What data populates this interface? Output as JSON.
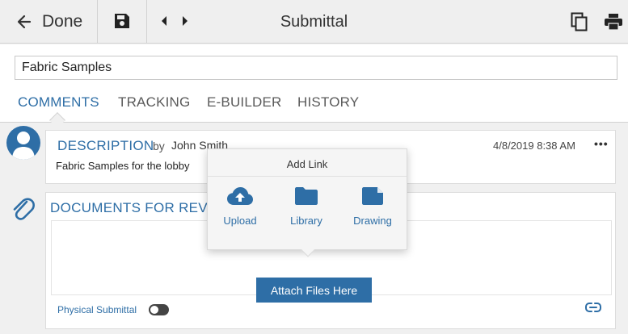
{
  "toolbar": {
    "done_label": "Done",
    "title": "Submittal",
    "icons": [
      "back-arrow-icon",
      "save-icon",
      "prev-icon",
      "next-icon",
      "copy-icon",
      "print-icon"
    ]
  },
  "form": {
    "name_value": "Fabric Samples"
  },
  "tabs": [
    {
      "label": "COMMENTS",
      "active": true
    },
    {
      "label": "TRACKING",
      "active": false
    },
    {
      "label": "E-BUILDER",
      "active": false
    },
    {
      "label": "HISTORY",
      "active": false
    }
  ],
  "description": {
    "title": "DESCRIPTION",
    "by": "by",
    "author": "John Smith",
    "date": "4/8/2019 8:38 AM",
    "more": "•••",
    "text": "Fabric Samples for the lobby"
  },
  "documents": {
    "title": "DOCUMENTS FOR REVIEW",
    "attach_label": "Attach Files Here",
    "physical_label": "Physical Submittal",
    "physical_on": false
  },
  "popup": {
    "title": "Add Link",
    "items": [
      {
        "label": "Upload",
        "icon": "cloud-upload-icon"
      },
      {
        "label": "Library",
        "icon": "folder-icon"
      },
      {
        "label": "Drawing",
        "icon": "drawing-icon"
      }
    ]
  },
  "colors": {
    "accent": "#2e6ea6",
    "toolbar_bg": "#efefef",
    "page_bg": "#f0f0f0"
  }
}
